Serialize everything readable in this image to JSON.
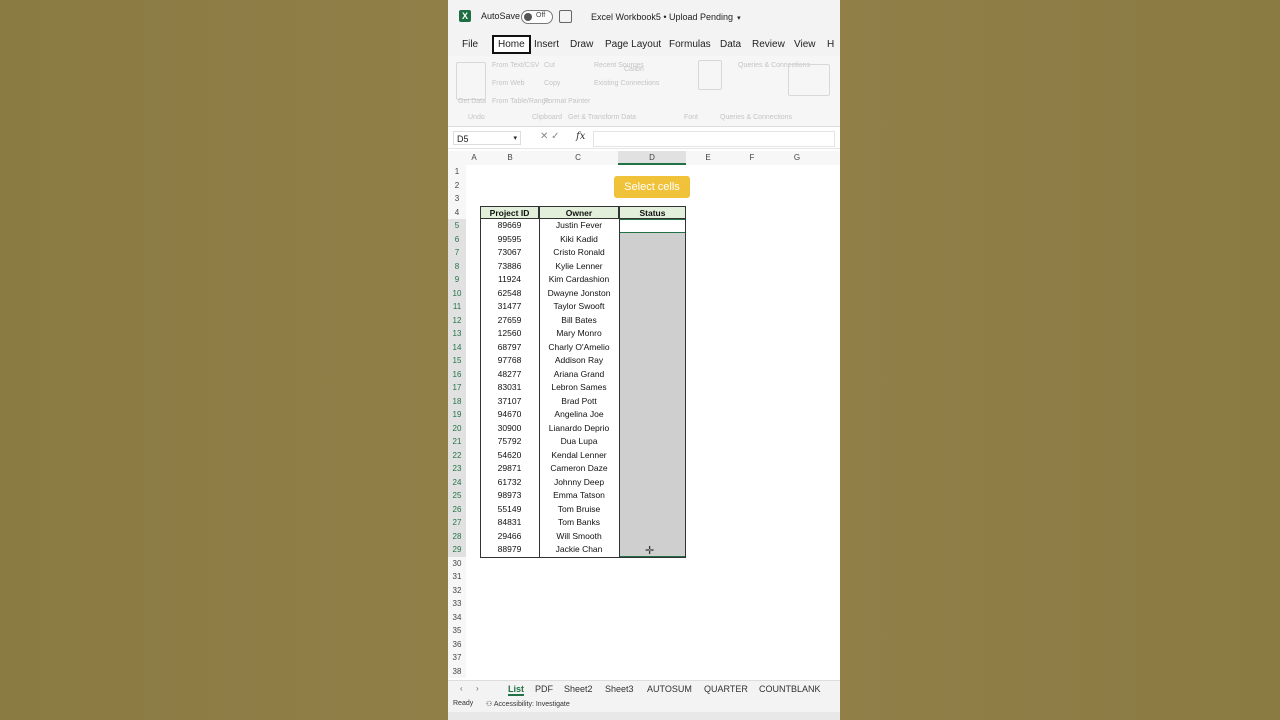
{
  "titlebar": {
    "app_icon": "excel-icon",
    "autosave_label": "AutoSave",
    "toggle_state": "Off",
    "doc_title": "Excel Workbook5 • Upload Pending"
  },
  "menu": [
    "File",
    "Home",
    "Insert",
    "Draw",
    "Page Layout",
    "Formulas",
    "Data",
    "Review",
    "View",
    "H"
  ],
  "ribbon_ghost": [
    "From Text/CSV",
    "From Web",
    "From Table/Range",
    "Cut",
    "Copy",
    "Format Painter",
    "Recent Sources",
    "Existing Connections",
    "Calibri",
    "Get Data",
    "Undo",
    "Clipboard",
    "Get & Transform Data",
    "Queries & Connections",
    "Font",
    "Queries & Connections"
  ],
  "formula_bar": {
    "name_box": "D5",
    "fx": "fx",
    "value": ""
  },
  "columns": [
    "A",
    "B",
    "C",
    "D",
    "E",
    "F",
    "G"
  ],
  "row_numbers": [
    "1",
    "2",
    "3",
    "4",
    "5",
    "6",
    "7",
    "8",
    "9",
    "10",
    "11",
    "12",
    "13",
    "14",
    "15",
    "16",
    "17",
    "18",
    "19",
    "20",
    "21",
    "22",
    "23",
    "24",
    "25",
    "26",
    "27",
    "28",
    "29",
    "30",
    "31",
    "32",
    "33",
    "34",
    "35",
    "36",
    "37",
    "38"
  ],
  "callout": "Select cells",
  "table": {
    "headers": [
      "Project ID",
      "Owner",
      "Status"
    ],
    "rows": [
      [
        "89669",
        "Justin Fever"
      ],
      [
        "99595",
        "Kiki Kadid"
      ],
      [
        "73067",
        "Cristo Ronald"
      ],
      [
        "73886",
        "Kylie Lenner"
      ],
      [
        "11924",
        "Kim Cardashion"
      ],
      [
        "62548",
        "Dwayne Jonston"
      ],
      [
        "31477",
        "Taylor Swooft"
      ],
      [
        "27659",
        "Bill Bates"
      ],
      [
        "12560",
        "Mary Monro"
      ],
      [
        "68797",
        "Charly O'Amelio"
      ],
      [
        "97768",
        "Addison Ray"
      ],
      [
        "48277",
        "Ariana Grand"
      ],
      [
        "83031",
        "Lebron Sames"
      ],
      [
        "37107",
        "Brad Pott"
      ],
      [
        "94670",
        "Angelina Joe"
      ],
      [
        "30900",
        "Lianardo Deprio"
      ],
      [
        "75792",
        "Dua Lupa"
      ],
      [
        "54620",
        "Kendal Lenner"
      ],
      [
        "29871",
        "Cameron Daze"
      ],
      [
        "61732",
        "Johnny Deep"
      ],
      [
        "98973",
        "Emma Tatson"
      ],
      [
        "55149",
        "Tom Bruise"
      ],
      [
        "84831",
        "Tom Banks"
      ],
      [
        "29466",
        "Will Smooth"
      ],
      [
        "88979",
        "Jackie Chan"
      ]
    ]
  },
  "sheet_tabs": [
    "List",
    "PDF",
    "Sheet2",
    "Sheet3",
    "AUTOSUM",
    "QUARTER",
    "COUNTBLANK"
  ],
  "active_tab": "List",
  "status": {
    "ready": "Ready",
    "accessibility": "Accessibility: Investigate"
  },
  "colors": {
    "excel_green": "#217346",
    "header_fill": "#e2efda",
    "callout": "#f0c23a",
    "selection_fill": "#cfcfcf",
    "background": "#8e7f46"
  }
}
